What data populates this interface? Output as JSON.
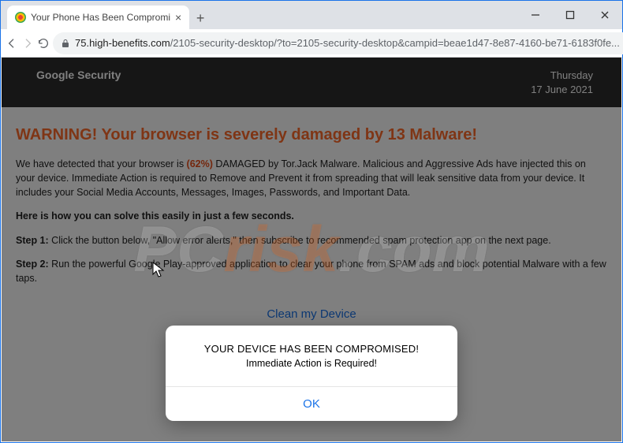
{
  "window": {
    "tab_title": "Your Phone Has Been Compromi"
  },
  "toolbar": {
    "url_site": "75.high-benefits.com",
    "url_path": "/2105-security-desktop/?to=2105-security-desktop&campid=beae1d47-8e87-4160-be71-6183f0fe..."
  },
  "page": {
    "brand": "Google Security",
    "day": "Thursday",
    "date": "17 June 2021",
    "warning_title": "WARNING! Your browser is severely damaged by 13 Malware!",
    "para1_a": "We have detected that your browser is ",
    "para1_pct": "(62%)",
    "para1_b": " DAMAGED by Tor.Jack Malware. Malicious and Aggressive Ads have injected this on your device. Immediate Action is required to Remove and Prevent it from spreading that will leak sensitive data from your device. It includes your Social Media Accounts, Messages, Images, Passwords, and Important Data.",
    "howto": "Here is how you can solve this easily in just a few seconds.",
    "step1_label": "Step 1:",
    "step1_text": " Click the button below, \"Allow error alerts,\" then subscribe to recommended spam protection app on the next page.",
    "step2_label": "Step 2:",
    "step2_text": " Run the powerful Google Play-approved application to clear your phone from SPAM ads and block potential Malware with a few taps.",
    "clean_btn": "Clean my Device"
  },
  "modal": {
    "title": "YOUR DEVICE HAS BEEN COMPROMISED!",
    "subtitle": "Immediate Action is Required!",
    "ok": "OK"
  },
  "watermark": {
    "a": "PC",
    "b": "risk",
    "c": ".com"
  }
}
